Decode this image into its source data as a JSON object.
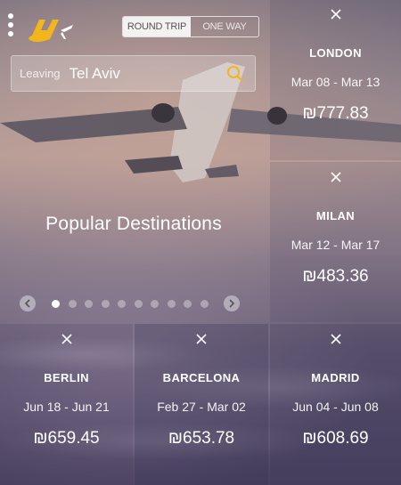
{
  "header": {
    "trip_toggle": {
      "round_trip": "ROUND TRIP",
      "one_way": "ONE WAY"
    }
  },
  "search": {
    "label": "Leaving",
    "value": "Tel Aviv"
  },
  "hero": {
    "title": "Popular Destinations"
  },
  "carousel": {
    "dot_count": 10,
    "active_index": 0
  },
  "destinations": [
    {
      "city": "LONDON",
      "dates": "Mar 08 - Mar 13",
      "price": "₪777.83"
    },
    {
      "city": "MILAN",
      "dates": "Mar 12 - Mar 17",
      "price": "₪483.36"
    },
    {
      "city": "BERLIN",
      "dates": "Jun 18 - Jun 21",
      "price": "₪659.45"
    },
    {
      "city": "BARCELONA",
      "dates": "Feb 27 - Mar 02",
      "price": "₪653.78"
    },
    {
      "city": "MADRID",
      "dates": "Jun 04 - Jun 08",
      "price": "₪608.69"
    }
  ],
  "colors": {
    "logo_yellow": "#f2b61c",
    "search_icon": "#f2b61c"
  }
}
